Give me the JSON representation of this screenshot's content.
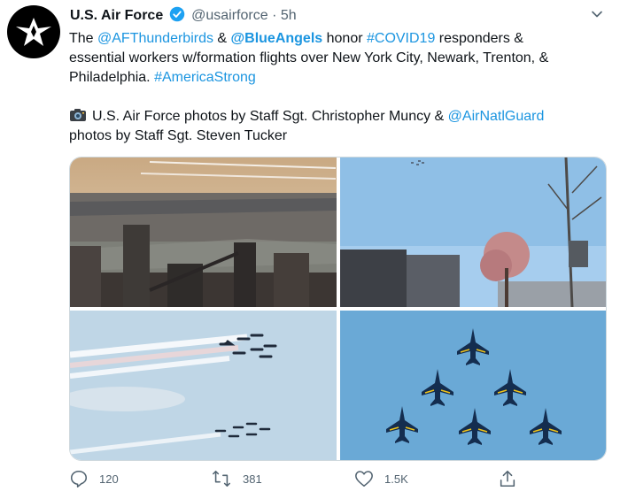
{
  "account": {
    "name": "U.S. Air Force",
    "handle": "@usairforce",
    "separator": "·",
    "time": "5h"
  },
  "icons": {
    "avatar": "air-force-logo",
    "verified": "verified-badge-icon",
    "menu": "chevron-down-icon",
    "camera": "camera-icon",
    "reply": "reply-icon",
    "retweet": "retweet-icon",
    "like": "heart-icon",
    "share": "share-icon"
  },
  "colors": {
    "link": "#1b95e0",
    "verified": "#1da1f2",
    "muted": "#536471"
  },
  "tweet": {
    "line1": {
      "t1": "The ",
      "mention1": "@AFThunderbirds",
      "t2": " & ",
      "mention2": "@BlueAngels",
      "t3": " honor ",
      "hashtag1": "#COVID19",
      "t4": " responders &"
    },
    "line2": "essential workers w/formation flights over New York City, Newark, Trenton, &",
    "line3": {
      "t1": "Philadelphia. ",
      "hashtag2": "#AmericaStrong"
    },
    "line4": {
      "t1": "U.S. Air Force photos by Staff Sgt. Christopher Muncy & ",
      "mention3": "@AirNatlGuard"
    },
    "line5": "photos by Staff Sgt. Steven Tucker"
  },
  "actions": {
    "replies": "120",
    "retweets": "381",
    "likes": "1.5K"
  }
}
